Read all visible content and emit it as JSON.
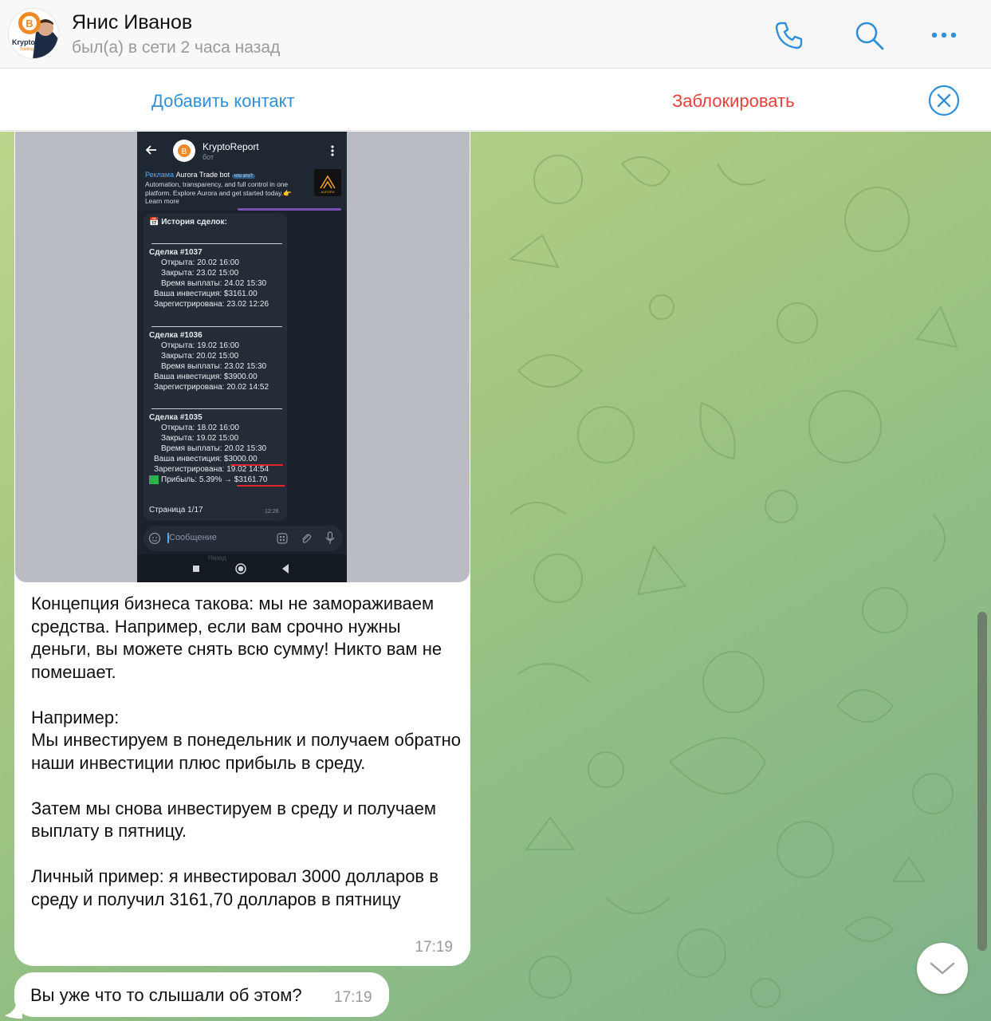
{
  "header": {
    "contact_name": "Янис Иванов",
    "status": "был(а) в сети 2 часа назад",
    "avatar_text": "Krypto",
    "avatar_subtext": "Trading"
  },
  "actionbar": {
    "add_contact": "Добавить контакт",
    "block": "Заблокировать"
  },
  "colors": {
    "accent_blue": "#2f8fd7",
    "danger_red": "#e3423b",
    "chat_bg": "#a6c880"
  },
  "messages": [
    {
      "text": "Концепция бизнеса такова: мы не замораживаем средства. Например, если вам срочно нужны деньги, вы можете снять всю сумму! Никто вам не помешает.\n\nНапример:\nМы инвестируем в понедельник и получаем обратно наши инвестиции плюс прибыль в среду.\n\nЗатем мы снова инвестируем в среду и получаем выплату в пятницу.\n\nЛичный пример: я инвестировал 3000 долларов в  среду и получил 3161,70 долларов в пятницу",
      "time": "17:19"
    },
    {
      "text": "Вы уже что то слышали об этом?",
      "time": "17:19"
    }
  ],
  "screenshot": {
    "bot_name": "KryptoReport",
    "bot_sub": "бот",
    "ad_label": "Реклама",
    "ad_title": "Aurora Trade bot",
    "ad_tag": "что это?",
    "ad_text": "Automation, transparency, and full control in one platform. Explore Aurora and get started today.👉 Learn more",
    "ad_logo": "AURORA",
    "history_title": "📅 История сделок:",
    "deals": [
      {
        "title": "Сделка #1037",
        "opened": "Открыта: 20.02 16:00",
        "closed": "Закрыта: 23.02 15:00",
        "payout": "Время выплаты: 24.02 15:30",
        "investment": "Ваша инвестиция: $3161.00",
        "registered": "Зарегистрирована: 23.02 12:26"
      },
      {
        "title": "Сделка #1036",
        "opened": "Открыта: 19.02 16:00",
        "closed": "Закрыта: 20.02 15:00",
        "payout": "Время выплаты: 23.02 15:30",
        "investment": "Ваша инвестиция: $3900.00",
        "registered": "Зарегистрирована: 20.02 14:52"
      },
      {
        "title": "Сделка #1035",
        "opened": "Открыта: 18.02 16:00",
        "closed": "Закрыта: 19.02 15:00",
        "payout": "Время выплаты: 20.02 15:30",
        "investment": "Ваша инвестиция: $3000.00",
        "registered": "Зарегистрирована: 19.02 14:54",
        "profit": "Прибыль: 5.39% → $3161.70"
      }
    ],
    "page": "Страница 1/17",
    "card_time": "12:26",
    "input_placeholder": "Сообщение",
    "nav_hint": "Назад"
  }
}
